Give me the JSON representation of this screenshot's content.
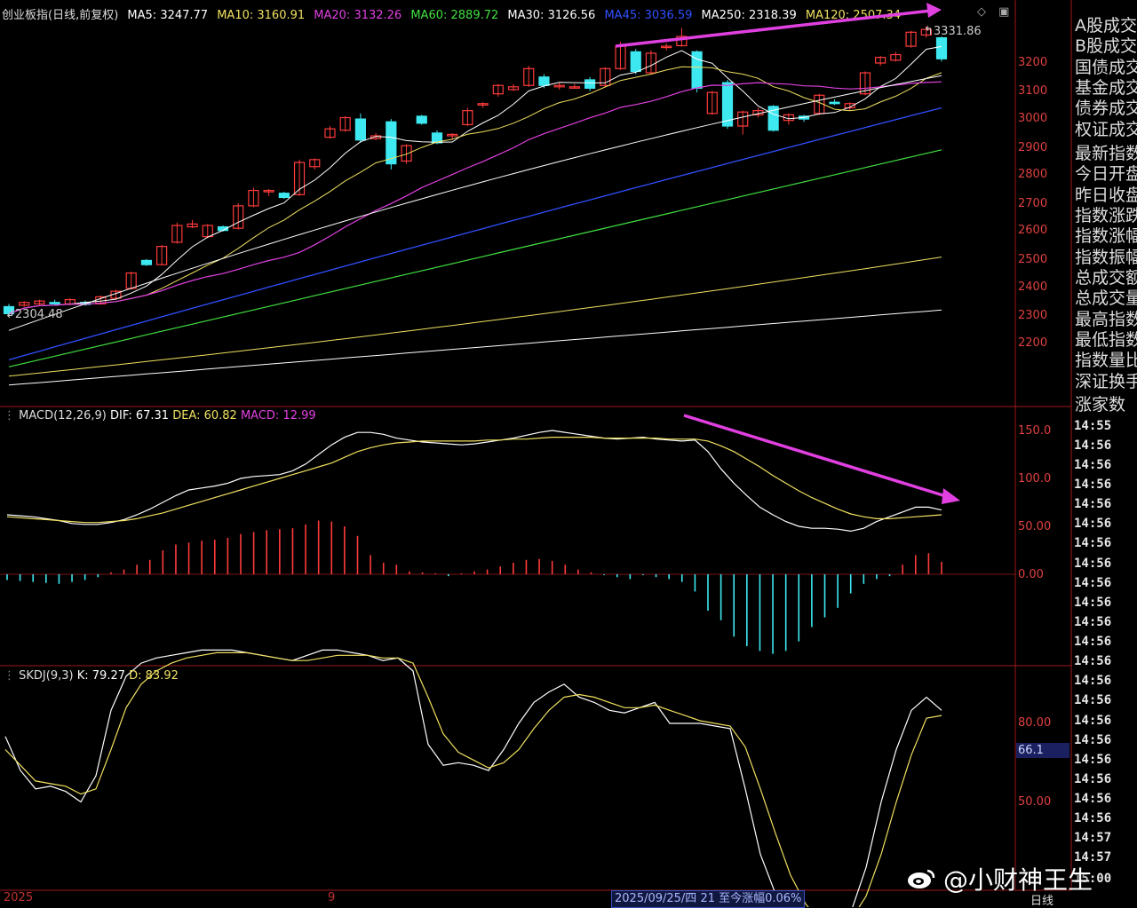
{
  "main_legend": {
    "title": "创业板指(日线,前复权)",
    "items": [
      {
        "label": "MA5: 3247.77",
        "color": "#ffffff"
      },
      {
        "label": "MA10: 3160.91",
        "color": "#f0e060"
      },
      {
        "label": "MA20: 3132.26",
        "color": "#e040e0"
      },
      {
        "label": "MA60: 2889.72",
        "color": "#40e040"
      },
      {
        "label": "MA30: 3126.56",
        "color": "#ffffff"
      },
      {
        "label": "MA45: 3036.59",
        "color": "#3050ff"
      },
      {
        "label": "MA250: 2318.39",
        "color": "#ffffff"
      },
      {
        "label": "MA120: 2507.34",
        "color": "#f0e060"
      }
    ]
  },
  "price_axis": [
    "3200",
    "3100",
    "3000",
    "2900",
    "2800",
    "2700",
    "2600",
    "2500",
    "2400",
    "2300",
    "2200"
  ],
  "macd_axis": [
    "150.0",
    "100.0",
    "50.00",
    "0.00"
  ],
  "skdj_axis": [
    "80.00",
    "50.00"
  ],
  "high_label": "3331.86",
  "low_label": "2304.48",
  "macd_legend": {
    "title": "MACD(12,26,9)",
    "dif": "DIF: 67.31",
    "dea": "DEA: 60.82",
    "macd": "MACD: 12.99"
  },
  "skdj_legend": {
    "title": "SKDJ(9,3)",
    "k": "K: 79.27",
    "d": "D: 83.92"
  },
  "skdj_current": "66.1",
  "sidebar_items": [
    "A股成交",
    "B股成交",
    "国债成交",
    "基金成交",
    "债券成交",
    "权证成交",
    "最新指数",
    "今日开盘",
    "昨日收盘",
    "指数涨跌",
    "指数涨幅",
    "指数振幅",
    "总成交额",
    "总成交量",
    "最高指数",
    "最低指数",
    "指数量比",
    "深证换手",
    "涨家数"
  ],
  "time_items": [
    "14:55",
    "14:56",
    "14:56",
    "14:56",
    "14:56",
    "14:56",
    "14:56",
    "14:56",
    "14:56",
    "14:56",
    "14:56",
    "14:56",
    "14:56",
    "14:56",
    "14:56",
    "14:56",
    "14:56",
    "14:56",
    "14:56",
    "14:56",
    "14:56",
    "14:57",
    "14:57",
    "15:00"
  ],
  "bottom": {
    "left_year": "2025",
    "month_tick": "9",
    "status": "2025/09/25/四 21 至今涨幅0.06%",
    "period": "日线"
  },
  "watermark": "@小财神王生",
  "colors": {
    "up": "#ff3b3b",
    "down": "#3ee8f0",
    "arrow": "#e040e0",
    "axis_red": "#c02020",
    "dif": "#ffffff",
    "dea": "#f0e060"
  },
  "chart_data": {
    "type": "candlestick",
    "candles": [
      {
        "o": 2330,
        "c": 2305,
        "h": 2340,
        "l": 2300
      },
      {
        "o": 2335,
        "c": 2345,
        "h": 2350,
        "l": 2330
      },
      {
        "o": 2340,
        "c": 2350,
        "h": 2355,
        "l": 2335
      },
      {
        "o": 2345,
        "c": 2340,
        "h": 2355,
        "l": 2335
      },
      {
        "o": 2340,
        "c": 2355,
        "h": 2360,
        "l": 2335
      },
      {
        "o": 2345,
        "c": 2338,
        "h": 2352,
        "l": 2333
      },
      {
        "o": 2340,
        "c": 2365,
        "h": 2370,
        "l": 2337
      },
      {
        "o": 2360,
        "c": 2385,
        "h": 2390,
        "l": 2355
      },
      {
        "o": 2395,
        "c": 2450,
        "h": 2455,
        "l": 2390
      },
      {
        "o": 2495,
        "c": 2480,
        "h": 2500,
        "l": 2475
      },
      {
        "o": 2480,
        "c": 2545,
        "h": 2550,
        "l": 2478
      },
      {
        "o": 2560,
        "c": 2620,
        "h": 2630,
        "l": 2555
      },
      {
        "o": 2615,
        "c": 2625,
        "h": 2640,
        "l": 2610
      },
      {
        "o": 2580,
        "c": 2620,
        "h": 2625,
        "l": 2575
      },
      {
        "o": 2615,
        "c": 2602,
        "h": 2620,
        "l": 2598
      },
      {
        "o": 2610,
        "c": 2690,
        "h": 2700,
        "l": 2605
      },
      {
        "o": 2690,
        "c": 2745,
        "h": 2755,
        "l": 2685
      },
      {
        "o": 2740,
        "c": 2745,
        "h": 2750,
        "l": 2725
      },
      {
        "o": 2735,
        "c": 2720,
        "h": 2740,
        "l": 2715
      },
      {
        "o": 2730,
        "c": 2845,
        "h": 2855,
        "l": 2725
      },
      {
        "o": 2830,
        "c": 2855,
        "h": 2860,
        "l": 2820
      },
      {
        "o": 2935,
        "c": 2965,
        "h": 2975,
        "l": 2930
      },
      {
        "o": 2960,
        "c": 3005,
        "h": 3010,
        "l": 2955
      },
      {
        "o": 3000,
        "c": 2925,
        "h": 3020,
        "l": 2915
      },
      {
        "o": 2930,
        "c": 2940,
        "h": 2950,
        "l": 2925
      },
      {
        "o": 2990,
        "c": 2840,
        "h": 3000,
        "l": 2820
      },
      {
        "o": 2850,
        "c": 2905,
        "h": 2910,
        "l": 2840
      },
      {
        "o": 3010,
        "c": 2985,
        "h": 3015,
        "l": 2980
      },
      {
        "o": 2950,
        "c": 2915,
        "h": 2960,
        "l": 2910
      },
      {
        "o": 2940,
        "c": 2945,
        "h": 2950,
        "l": 2925
      },
      {
        "o": 2980,
        "c": 3030,
        "h": 3040,
        "l": 2975
      },
      {
        "o": 3050,
        "c": 3055,
        "h": 3060,
        "l": 3040
      },
      {
        "o": 3090,
        "c": 3120,
        "h": 3125,
        "l": 3080
      },
      {
        "o": 3105,
        "c": 3115,
        "h": 3125,
        "l": 3100
      },
      {
        "o": 3120,
        "c": 3180,
        "h": 3190,
        "l": 3115
      },
      {
        "o": 3150,
        "c": 3120,
        "h": 3160,
        "l": 3110
      },
      {
        "o": 3115,
        "c": 3120,
        "h": 3130,
        "l": 3105
      },
      {
        "o": 3115,
        "c": 3115,
        "h": 3125,
        "l": 3108
      },
      {
        "o": 3140,
        "c": 3110,
        "h": 3150,
        "l": 3100
      },
      {
        "o": 3120,
        "c": 3180,
        "h": 3185,
        "l": 3115
      },
      {
        "o": 3180,
        "c": 3260,
        "h": 3275,
        "l": 3175
      },
      {
        "o": 3240,
        "c": 3170,
        "h": 3250,
        "l": 3160
      },
      {
        "o": 3165,
        "c": 3235,
        "h": 3245,
        "l": 3160
      },
      {
        "o": 3260,
        "c": 3260,
        "h": 3270,
        "l": 3245
      },
      {
        "o": 3262,
        "c": 3295,
        "h": 3325,
        "l": 3258
      },
      {
        "o": 3240,
        "c": 3110,
        "h": 3245,
        "l": 3095
      },
      {
        "o": 3020,
        "c": 3095,
        "h": 3100,
        "l": 3015
      },
      {
        "o": 3130,
        "c": 2975,
        "h": 3140,
        "l": 2965
      },
      {
        "o": 2975,
        "c": 3025,
        "h": 3030,
        "l": 2945
      },
      {
        "o": 3015,
        "c": 3030,
        "h": 3040,
        "l": 3005
      },
      {
        "o": 3045,
        "c": 2960,
        "h": 3050,
        "l": 2955
      },
      {
        "o": 2995,
        "c": 3015,
        "h": 3020,
        "l": 2980
      },
      {
        "o": 3010,
        "c": 3000,
        "h": 3015,
        "l": 2990
      },
      {
        "o": 3020,
        "c": 3085,
        "h": 3090,
        "l": 3015
      },
      {
        "o": 3060,
        "c": 3055,
        "h": 3070,
        "l": 3050
      },
      {
        "o": 3040,
        "c": 3055,
        "h": 3060,
        "l": 3030
      },
      {
        "o": 3090,
        "c": 3165,
        "h": 3170,
        "l": 3085
      },
      {
        "o": 3200,
        "c": 3220,
        "h": 3225,
        "l": 3190
      },
      {
        "o": 3210,
        "c": 3230,
        "h": 3240,
        "l": 3205
      },
      {
        "o": 3260,
        "c": 3310,
        "h": 3315,
        "l": 3255
      },
      {
        "o": 3300,
        "c": 3320,
        "h": 3332,
        "l": 3290
      },
      {
        "o": 3290,
        "c": 3215,
        "h": 3295,
        "l": 3205
      }
    ],
    "macd_hist": [
      -6,
      -7,
      -8,
      -9,
      -10,
      -8,
      -6,
      -3,
      2,
      5,
      10,
      15,
      25,
      31,
      33,
      35,
      36,
      38,
      42,
      44,
      46,
      47,
      48,
      52,
      56,
      55,
      50,
      40,
      20,
      12,
      10,
      3,
      2,
      1,
      -2,
      1,
      3,
      5,
      8,
      12,
      15,
      16,
      14,
      10,
      5,
      2,
      -1,
      -3,
      -5,
      -1,
      -3,
      -5,
      -8,
      -18,
      -38,
      -48,
      -65,
      -75,
      -80,
      -83,
      -80,
      -70,
      -55,
      -45,
      -35,
      -20,
      -10,
      -5,
      -2,
      10,
      20,
      22,
      13
    ],
    "dif": [
      62,
      61,
      60,
      58,
      56,
      53,
      52,
      52,
      54,
      57,
      62,
      68,
      75,
      82,
      88,
      90,
      92,
      95,
      100,
      102,
      103,
      104,
      108,
      115,
      125,
      135,
      143,
      148,
      148,
      146,
      142,
      140,
      138,
      137,
      136,
      135,
      136,
      138,
      140,
      142,
      145,
      148,
      150,
      148,
      146,
      144,
      142,
      141,
      142,
      143,
      141,
      140,
      139,
      140,
      128,
      110,
      95,
      82,
      70,
      62,
      55,
      50,
      48,
      48,
      47,
      45,
      48,
      55,
      60,
      65,
      70,
      70,
      67
    ],
    "dea": [
      60,
      59,
      58,
      57,
      56,
      55,
      54,
      54,
      55,
      56,
      58,
      61,
      64,
      68,
      72,
      76,
      80,
      84,
      88,
      92,
      96,
      100,
      104,
      108,
      112,
      116,
      122,
      128,
      132,
      135,
      137,
      138,
      139,
      139,
      139,
      139,
      139,
      140,
      140,
      141,
      141,
      142,
      143,
      143,
      143,
      143,
      142,
      142,
      142,
      142,
      142,
      141,
      141,
      141,
      139,
      134,
      128,
      120,
      112,
      103,
      95,
      87,
      80,
      74,
      68,
      63,
      60,
      58,
      58,
      59,
      60,
      61,
      62
    ],
    "skdj_k": [
      75,
      62,
      55,
      56,
      54,
      50,
      60,
      85,
      98,
      103,
      105,
      106,
      107,
      108,
      108,
      108,
      107,
      106,
      105,
      104,
      106,
      108,
      108,
      107,
      106,
      104,
      105,
      100,
      72,
      64,
      65,
      64,
      62,
      70,
      80,
      88,
      92,
      95,
      90,
      88,
      85,
      84,
      86,
      88,
      80,
      80,
      80,
      79,
      78,
      55,
      30,
      15,
      8,
      5,
      0,
      2,
      8,
      25,
      50,
      70,
      85,
      90,
      85
    ],
    "skdj_d": [
      70,
      64,
      58,
      57,
      56,
      53,
      55,
      70,
      86,
      95,
      100,
      103,
      105,
      106,
      107,
      107,
      107,
      106,
      105,
      104,
      104,
      105,
      106,
      106,
      106,
      105,
      105,
      103,
      90,
      76,
      69,
      66,
      63,
      65,
      70,
      78,
      85,
      90,
      91,
      90,
      88,
      86,
      86,
      87,
      85,
      83,
      81,
      80,
      79,
      71,
      55,
      38,
      22,
      11,
      4,
      2,
      5,
      14,
      30,
      50,
      68,
      82,
      83
    ]
  }
}
